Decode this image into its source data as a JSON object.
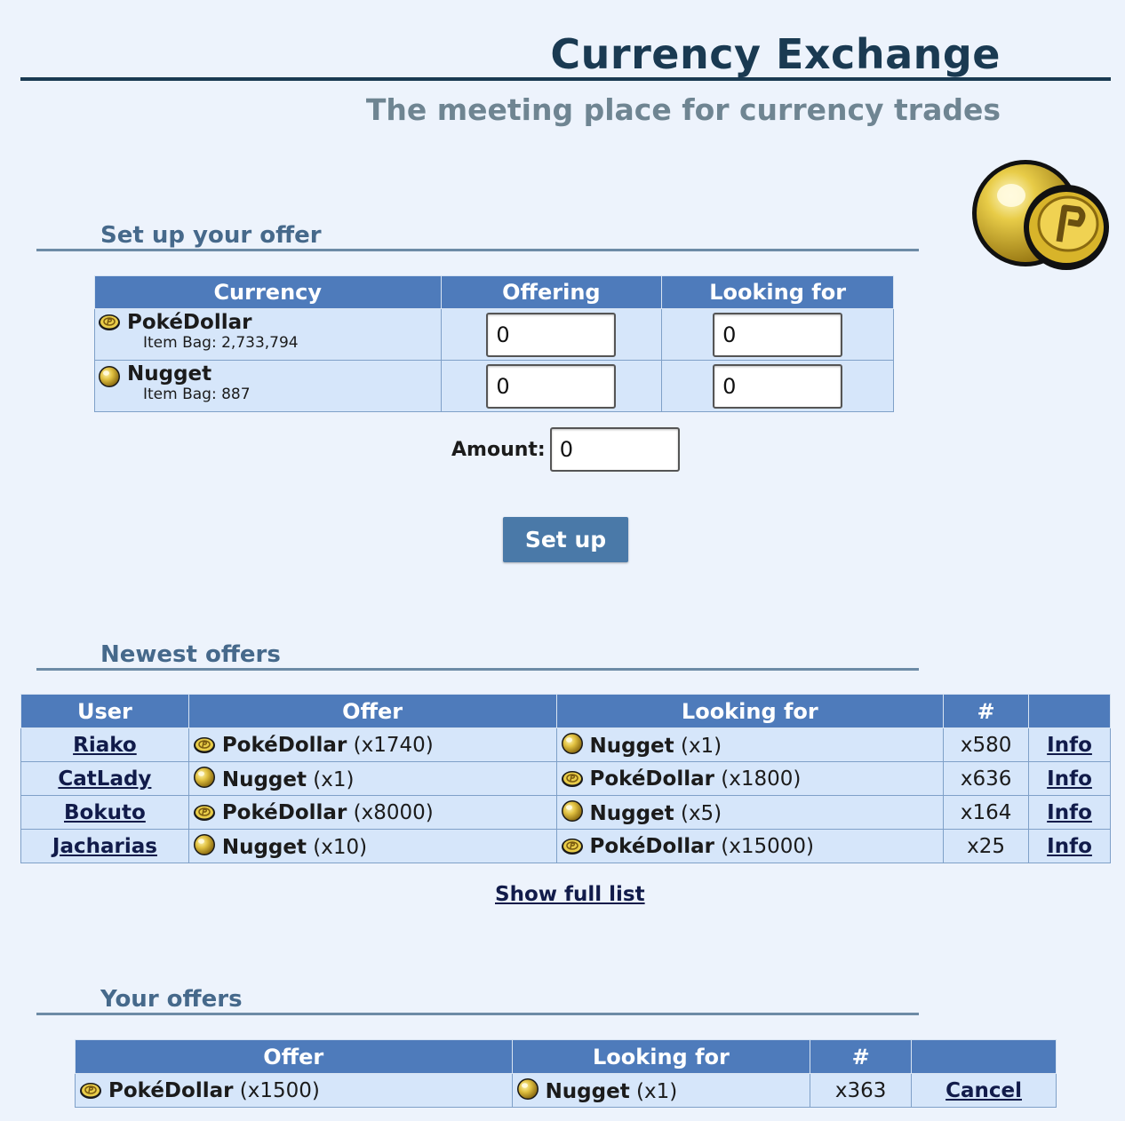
{
  "header": {
    "title": "Currency Exchange",
    "subtitle": "The meeting place for currency trades"
  },
  "setup": {
    "section_title": "Set up your offer",
    "columns": [
      "Currency",
      "Offering",
      "Looking for"
    ],
    "rows": [
      {
        "icon": "pokedollar-icon",
        "name": "PokéDollar",
        "bag": "Item Bag: 2,733,794",
        "offering": "0",
        "looking_for": "0"
      },
      {
        "icon": "nugget-icon",
        "name": "Nugget",
        "bag": "Item Bag: 887",
        "offering": "0",
        "looking_for": "0"
      }
    ],
    "amount_label": "Amount:",
    "amount_value": "0",
    "button_label": "Set up"
  },
  "newest": {
    "section_title": "Newest offers",
    "columns": [
      "User",
      "Offer",
      "Looking for",
      "#",
      ""
    ],
    "rows": [
      {
        "user": "Riako",
        "offer_icon": "pokedollar-icon",
        "offer_name": "PokéDollar",
        "offer_qty": "(x1740)",
        "want_icon": "nugget-icon",
        "want_name": "Nugget",
        "want_qty": "(x1)",
        "count": "x580",
        "info": "Info"
      },
      {
        "user": "CatLady",
        "offer_icon": "nugget-icon",
        "offer_name": "Nugget",
        "offer_qty": "(x1)",
        "want_icon": "pokedollar-icon",
        "want_name": "PokéDollar",
        "want_qty": "(x1800)",
        "count": "x636",
        "info": "Info"
      },
      {
        "user": "Bokuto",
        "offer_icon": "pokedollar-icon",
        "offer_name": "PokéDollar",
        "offer_qty": "(x8000)",
        "want_icon": "nugget-icon",
        "want_name": "Nugget",
        "want_qty": "(x5)",
        "count": "x164",
        "info": "Info"
      },
      {
        "user": "Jacharias",
        "offer_icon": "nugget-icon",
        "offer_name": "Nugget",
        "offer_qty": "(x10)",
        "want_icon": "pokedollar-icon",
        "want_name": "PokéDollar",
        "want_qty": "(x15000)",
        "count": "x25",
        "info": "Info"
      }
    ],
    "show_full": "Show full list"
  },
  "yours": {
    "section_title": "Your offers",
    "columns": [
      "Offer",
      "Looking for",
      "#",
      ""
    ],
    "rows": [
      {
        "offer_icon": "pokedollar-icon",
        "offer_name": "PokéDollar",
        "offer_qty": "(x1500)",
        "want_icon": "nugget-icon",
        "want_name": "Nugget",
        "want_qty": "(x1)",
        "count": "x363",
        "action": "Cancel"
      }
    ]
  },
  "colors": {
    "background": "#edf3fc",
    "header_row": "#4e7bbb",
    "cell_bg": "#d6e6fa",
    "title": "#1a3a52",
    "section_title": "#46698b",
    "button": "#4a79a8"
  }
}
